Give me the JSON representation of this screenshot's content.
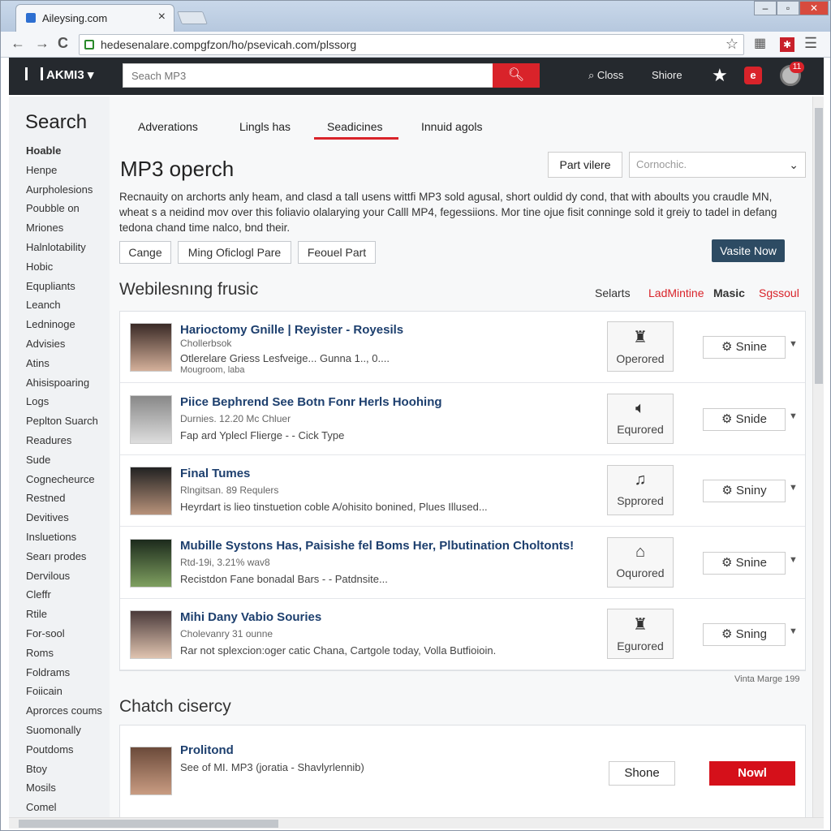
{
  "browser": {
    "tab_title": "Aileysing.com",
    "tab_close": "×",
    "url": "hedesenalare.compgfzon/ho/psevicah.com/plssorg",
    "back": "←",
    "forward": "→",
    "reload": "C"
  },
  "site_header": {
    "logo": "AKMI3",
    "search_placeholder": "Seach MP3",
    "search_icon": "search-icon",
    "links": [
      "Closs",
      "Shiore"
    ],
    "badge": "11"
  },
  "sidebar": {
    "title": "Search",
    "items": [
      "Hoable",
      "Henpe",
      "Aurpholesions",
      "Poubble on",
      "Mriones",
      "Halnlotability",
      "Hobic",
      "Equpliants",
      "Leanch",
      "Ledninoge",
      "Advisies",
      "Atins",
      "Ahisispoaring",
      "Logs",
      "Peplton Suarch",
      "Readures",
      "Sude",
      "Cognecheurce",
      "Restned",
      "Devitives",
      "Insluetions",
      "Searı prodes",
      "Dervilous",
      "Cleffr",
      "Rtile",
      "For-sool",
      "Roms",
      "Foldrams",
      "Foiicain",
      "Aprorces coums",
      "Suomonally",
      "Poutdoms",
      "Btoy",
      "Mosils",
      "Comel"
    ]
  },
  "tabs": [
    "Adverations",
    "Lingls has",
    "Seadicines",
    "Innuid agols"
  ],
  "active_tab_index": 2,
  "main": {
    "title": "MP3 operch",
    "part_button": "Part vilere",
    "select_value": "Cornochic.",
    "description": "Recnauity on archorts anly heam, and clasd a tall usens wittfi MP3 sold agusal, short ouldid dy cond, that with aboults you craudle MN, wheat s a neidind mov over this foliavio olalarying your Calll MP4, fegessiions. Mor tine ojue fisit conninge sold it greiy to tadel in defang tedona chand time nalco, bnd their.",
    "chips": [
      "Cange",
      "Ming Oficlogl Pare",
      "Feouel Part"
    ],
    "visit_button": "Vasite Now",
    "section_title": "Webilesnıng frusic",
    "filters": [
      "Selarts",
      "LadMintine",
      "Masic",
      "Sgssoul"
    ],
    "note": "Vinta Marge 199",
    "section2_title": "Chatch cisercy"
  },
  "results": [
    {
      "title": "Harioctomy Gnille | Reyister - Royesils",
      "sub1": "Chollerbsok",
      "sub2": "Otlerelare Griess Lesfveige... Gunna 1.., 0....",
      "sub3": "Mougroom, laba",
      "icon_name": "building-icon",
      "icon_label": "Operored",
      "action": "Snine",
      "avatar": "avatar-woman"
    },
    {
      "title": "Piice Bephrend See Botn Fonr Herls Hoohing",
      "sub1": "Durnies. 12.20 Mc Chluer",
      "sub2": "Fap ard Yplecl Flierge - - Cick Type",
      "sub3": "",
      "icon_name": "speaker-icon",
      "icon_label": "Equrored",
      "action": "Snide",
      "avatar": "avatar-group"
    },
    {
      "title": "Final Tumes",
      "sub1": "Rlngitsan. 89 Requlers",
      "sub2": "Heyrdart is lieo tinstuetion coble A/ohisito bonined, Plues Illused...",
      "sub3": "",
      "icon_name": "music-note-icon",
      "icon_label": "Spprored",
      "action": "Sniny",
      "avatar": "avatar-man"
    },
    {
      "title": "Mubille Systons Has, Paisishe fel Boms Her, Plbutination Choltonts!",
      "sub1": "Rtd-19i, 3.21% wav8",
      "sub2": "Recistdon Fane bonadal Bars - - Patdnsite...",
      "sub3": "",
      "icon_name": "home-icon",
      "icon_label": "Oqurored",
      "action": "Snine",
      "avatar": "avatar-album"
    },
    {
      "title": "Mihi Dany Vabio Souries",
      "sub1": "Cholevanry 31 ounne",
      "sub2": "Rar not splexcion:oger catic Chana, Cartgole today, Volla Butfioioin.",
      "sub3": "",
      "icon_name": "building-icon",
      "icon_label": "Egurored",
      "action": "Sning",
      "avatar": "avatar-man2"
    }
  ],
  "card": {
    "title": "Prolitond",
    "sub": "See of MI. MP3 (joratia - Shavlyrlennib)",
    "button1": "Shone",
    "button2": "Nowl"
  }
}
